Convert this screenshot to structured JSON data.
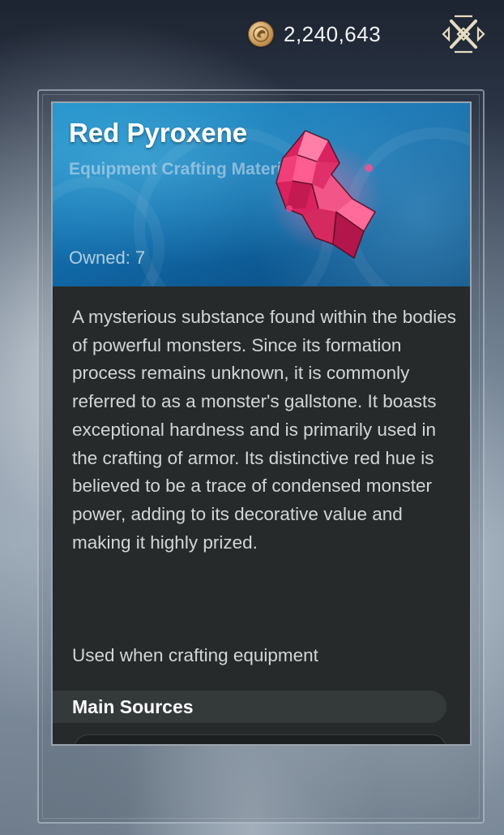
{
  "topbar": {
    "currency_icon": "coin-icon",
    "currency_amount": "2,240,643",
    "close_icon": "close-icon"
  },
  "item": {
    "name": "Red Pyroxene",
    "category": "Equipment Crafting Materials",
    "owned_label": "Owned:",
    "owned_count": "7",
    "icon": "red-crystal-icon",
    "description": "A mysterious substance found within the bodies of powerful monsters. Since its formation process remains unknown, it is commonly referred to as a monster's gallstone. It boasts exceptional hardness and is primarily used in the crafting of armor. Its distinctive red hue is believed to be a trace of condensed monster power, adding to its decorative value and making it highly prized.",
    "usage": "Used when crafting equipment"
  },
  "sources": {
    "title": "Main Sources"
  },
  "colors": {
    "header_blue": "#126fae",
    "gem_pink": "#e8306f",
    "card_bg": "#262a2a"
  }
}
